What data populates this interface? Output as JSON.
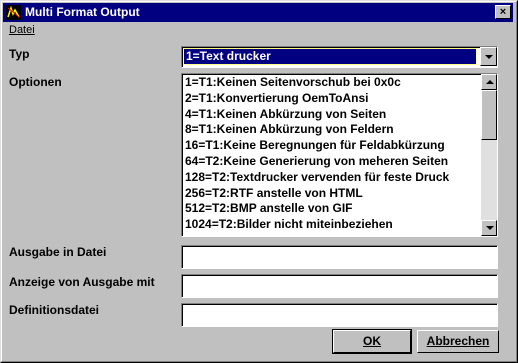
{
  "window": {
    "title": "Multi Format Output",
    "close_label": "×"
  },
  "menu": {
    "items": [
      {
        "label": "Datei"
      }
    ]
  },
  "typ": {
    "label": "Typ",
    "value": "1=Text drucker"
  },
  "optionen": {
    "label": "Optionen",
    "items": [
      "1=T1:Keinen Seitenvorschub bei 0x0c",
      "2=T1:Konvertierung OemToAnsi",
      "4=T1:Keinen Abkürzung von Seiten",
      "8=T1:Keinen Abkürzung von Feldern",
      "16=T1:Keine Beregnungen für Feldabkürzung",
      "64=T2:Keine Generierung von meheren Seiten",
      "128=T2:Textdrucker vervenden für feste Druck",
      "256=T2:RTF anstelle von HTML",
      "512=T2:BMP anstelle von GIF",
      "1024=T2:Bilder nicht miteinbeziehen"
    ]
  },
  "ausgabe_datei": {
    "label": "Ausgabe in Datei",
    "value": ""
  },
  "anzeige_ausgabe": {
    "label": "Anzeige von Ausgabe mit",
    "value": ""
  },
  "definitionsdatei": {
    "label": "Definitionsdatei",
    "value": ""
  },
  "buttons": {
    "ok": "OK",
    "cancel": "Abbrechen"
  },
  "colors": {
    "titlebar": "#000080",
    "face": "#c0c0c0",
    "selection": "#000080"
  }
}
